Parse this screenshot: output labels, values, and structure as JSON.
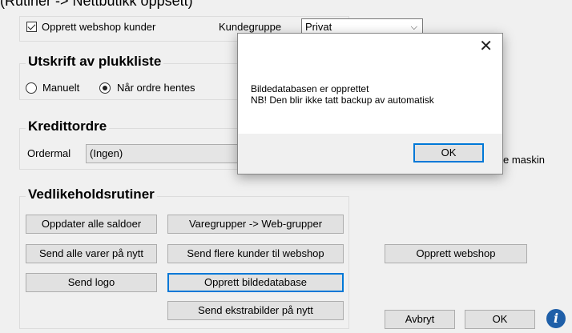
{
  "window": {
    "title_partial": "(Rutiner -> Nettbutikk oppsett)"
  },
  "webshop": {
    "create_customers_label": "Opprett webshop kunder",
    "customer_group_label": "Kundegruppe",
    "customer_group_value": "Privat"
  },
  "print_section": {
    "title": "Utskrift av plukkliste",
    "manual_label": "Manuelt",
    "on_fetch_label": "Når ordre hentes"
  },
  "credit_section": {
    "title": "Kredittordre",
    "template_label": "Ordermal",
    "template_value": "(Ingen)",
    "machine_label_partial": "e maskin"
  },
  "maintenance": {
    "title": "Vedlikeholdsrutiner",
    "update_balances": "Oppdater alle saldoer",
    "send_all_items": "Send alle varer på nytt",
    "send_logo": "Send logo",
    "item_groups_web": "Varegrupper -> Web-grupper",
    "send_customers": "Send flere kunder til webshop",
    "create_image_db": "Opprett bildedatabase",
    "send_extra_images": "Send ekstrabilder på nytt"
  },
  "actions": {
    "create_webshop": "Opprett webshop",
    "cancel": "Avbryt",
    "ok": "OK"
  },
  "dialog": {
    "close_symbol": "✕",
    "line1": "Bildedatabasen er opprettet",
    "line2": "NB! Den blir ikke tatt backup av automatisk",
    "ok": "OK"
  },
  "icons": {
    "info": "i",
    "chevron": "⌵"
  }
}
